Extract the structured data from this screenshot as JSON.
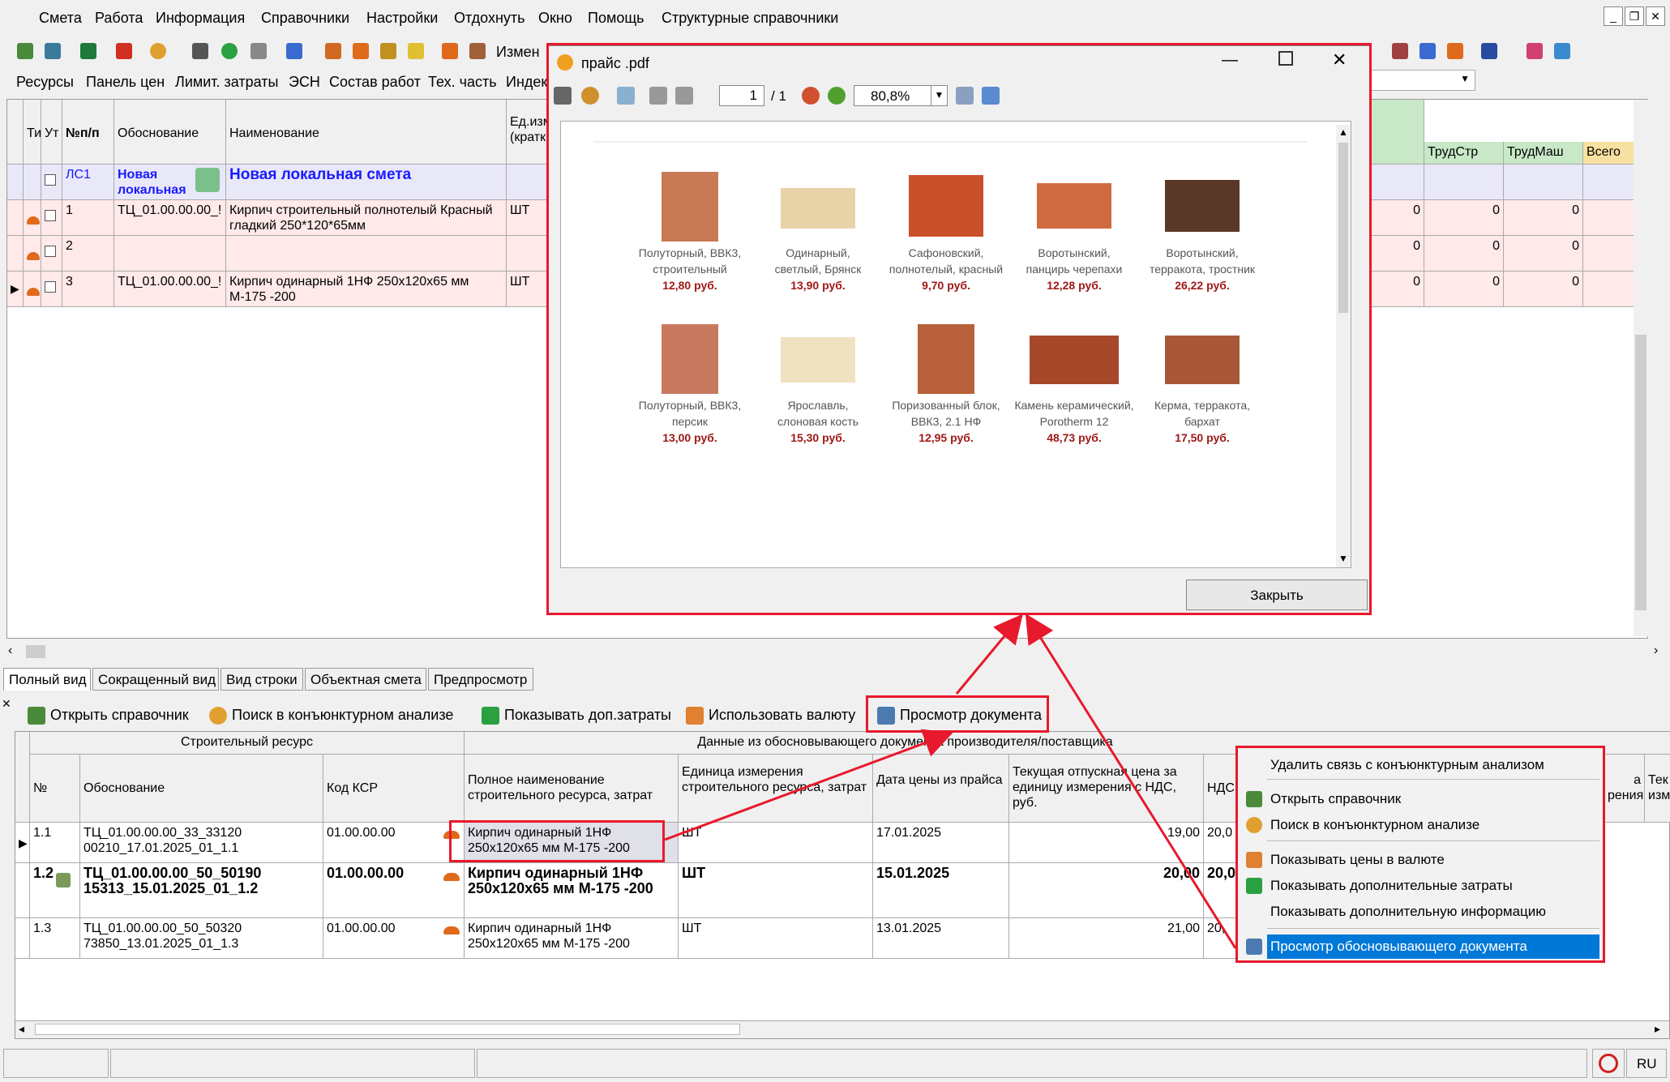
{
  "menu": [
    "Смета",
    "Работа",
    "Информация",
    "Справочники",
    "Настройки",
    "Отдохнуть",
    "Окно",
    "Помощь",
    "Структурные справочники"
  ],
  "toolbar": {
    "change_label": "Измен"
  },
  "panel": [
    "Ресурсы",
    "Панель цен",
    "Лимит. затраты",
    "ЭСН",
    "Состав работ",
    "Тех. часть",
    "Индек"
  ],
  "grid": {
    "headers": {
      "ti": "Ти",
      "ut": "Ут",
      "num": "№п/п",
      "obosn": "Обоснование",
      "name": "Наименование",
      "unit": "Ед.изм (кратк",
      "trudstr": "ТрудСтр",
      "trudmash": "ТрудМаш",
      "vsego": "Всего"
    },
    "rows": [
      {
        "num": "ЛС1",
        "obosn": "Новая локальная",
        "name": "Новая локальная смета",
        "unit": "",
        "trudstr": "",
        "trudmash": "",
        "v1": ""
      },
      {
        "num": "1",
        "obosn": "ТЦ_01.00.00.00_!",
        "name": "Кирпич строительный полнотелый Красный гладкий 250*120*65мм",
        "unit": "ШТ",
        "v1": "0",
        "trudstr": "0",
        "trudmash": "0"
      },
      {
        "num": "2",
        "obosn": "",
        "name": "",
        "unit": "",
        "v1": "0",
        "trudstr": "0",
        "trudmash": "0"
      },
      {
        "num": "3",
        "obosn": "ТЦ_01.00.00.00_!",
        "name": "Кирпич одинарный 1НФ 250х120х65 мм М-175 -200",
        "unit": "ШТ",
        "v1": "0",
        "trudstr": "0",
        "trudmash": "0"
      }
    ]
  },
  "tabs": [
    "Полный вид",
    "Сокращенный вид",
    "Вид строки",
    "Объектная смета",
    "Предпросмотр"
  ],
  "bottom_buttons": [
    "Открыть справочник",
    "Поиск в конъюнктурном анализе",
    "Показывать доп.затраты",
    "Использовать валюту",
    "Просмотр документа"
  ],
  "grid2": {
    "group1": "Строительный ресурс",
    "group2": "Данные из обосновывающего документа производителя/поставщика",
    "headers": {
      "n": "№",
      "obosn": "Обоснование",
      "ksr": "Код КСР",
      "full": "Полное наименование строительного ресурса, затрат",
      "unit": "Единица измерения строительного ресурса, затрат",
      "date": "Дата цены из прайса",
      "price": "Текущая отпускная цена за единицу измерения с НДС, руб.",
      "nds": "НДС, %",
      "edge1": "а",
      "edge1b": "рения",
      "edge2": "Тек",
      "edge2b": "изм"
    },
    "rows": [
      {
        "n": "1.1",
        "obosn": "ТЦ_01.00.00.00_33_33120 00210_17.01.2025_01_1.1",
        "ksr": "01.00.00.00",
        "full": "Кирпич одинарный 1НФ 250х120х65 мм М-175 -200",
        "unit": "ШТ",
        "date": "17.01.2025",
        "price": "19,00",
        "nds": "20,0"
      },
      {
        "n": "1.2",
        "obosn": "ТЦ_01.00.00.00_50_50190 15313_15.01.2025_01_1.2",
        "ksr": "01.00.00.00",
        "full": "Кирпич одинарный 1НФ 250х120х65 мм М-175 -200",
        "unit": "ШТ",
        "date": "15.01.2025",
        "price": "20,00",
        "nds": "20,0"
      },
      {
        "n": "1.3",
        "obosn": "ТЦ_01.00.00.00_50_50320 73850_13.01.2025_01_1.3",
        "ksr": "01.00.00.00",
        "full": "Кирпич одинарный 1НФ 250х120х65 мм М-175 -200",
        "unit": "ШТ",
        "date": "13.01.2025",
        "price": "21,00",
        "nds": "20,"
      }
    ]
  },
  "pdf": {
    "title": "прайс .pdf",
    "page": "1",
    "pages": "/ 1",
    "zoom": "80,8%",
    "close": "Закрыть",
    "products": [
      {
        "n1": "Полуторный, ВВК3,",
        "n2": "строительный",
        "price": "12,80 руб."
      },
      {
        "n1": "Одинарный,",
        "n2": "светлый, Брянск",
        "price": "13,90 руб."
      },
      {
        "n1": "Сафоновский,",
        "n2": "полнотелый, красный",
        "price": "9,70 руб."
      },
      {
        "n1": "Воротынский,",
        "n2": "панцирь черепахи",
        "price": "12,28 руб."
      },
      {
        "n1": "Воротынский,",
        "n2": "терракота, тростник",
        "price": "26,22 руб."
      },
      {
        "n1": "Полуторный, ВВК3,",
        "n2": "персик",
        "price": "13,00 руб."
      },
      {
        "n1": "Ярославль,",
        "n2": "слоновая кость",
        "price": "15,30 руб."
      },
      {
        "n1": "Поризованный блок,",
        "n2": "ВВК3, 2.1 НФ",
        "price": "12,95 руб."
      },
      {
        "n1": "Камень керамический,",
        "n2": "Porotherm 12",
        "price": "48,73 руб."
      },
      {
        "n1": "Керма, терракота,",
        "n2": "бархат",
        "price": "17,50 руб."
      }
    ]
  },
  "context_menu": [
    "Удалить связь с конъюнктурным анализом",
    "Открыть справочник",
    "Поиск в конъюнктурном анализе",
    "Показывать цены в валюте",
    "Показывать дополнительные затраты",
    "Показывать дополнительную информацию",
    "Просмотр обосновывающего документа"
  ],
  "status": {
    "lang": "RU"
  },
  "colors": {
    "highlight": "#0078d7",
    "annotation": "#e8192c",
    "pink_row": "#ffe9e9"
  }
}
